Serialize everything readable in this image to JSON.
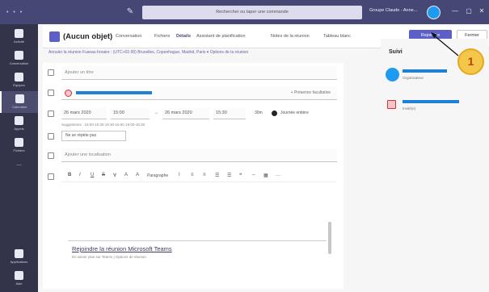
{
  "topbar": {
    "search_placeholder": "Rechercher ou taper une commande",
    "tenant_label": "Groupe Claude - Anne...",
    "minimize_glyph": "—",
    "maximize_glyph": "▢"
  },
  "rail": {
    "items": [
      {
        "label": "Activité",
        "icon": "bell-icon"
      },
      {
        "label": "Conversation",
        "icon": "chat-icon"
      },
      {
        "label": "Équipes",
        "icon": "teams-icon"
      },
      {
        "label": "Calendrier",
        "icon": "calendar-icon"
      },
      {
        "label": "Appels",
        "icon": "phone-icon"
      },
      {
        "label": "Fichiers",
        "icon": "file-icon"
      },
      {
        "label": "...",
        "icon": "more-icon"
      }
    ],
    "bottom_items": [
      {
        "label": "Applications",
        "icon": "apps-icon"
      },
      {
        "label": "Aide",
        "icon": "help-icon"
      }
    ]
  },
  "meeting": {
    "title": "(Aucun objet)",
    "tabs": [
      "Conversation",
      "Fichiers",
      "Détails",
      "Assistant de planification",
      "Notes de la réunion",
      "Tableau blanc"
    ],
    "active_tab_index": 2,
    "join_button": "Rejoindre",
    "close_button": "Fermer",
    "timezone_row": "Annuler la réunion   Fuseau horaire : (UTC+01:00) Bruxelles, Copenhague, Madrid, Paris  ▾   Options de la réunion"
  },
  "form": {
    "title_placeholder": "Ajouter un titre",
    "optional_label": "+ Présence facultative",
    "start_date": "26 mars 2020",
    "start_time": "15:00",
    "end_date": "26 mars 2020",
    "end_time": "15:30",
    "duration": "30m",
    "all_day_label": "Journée entière",
    "suggestions": "Suggestions : 15:00-15:30   15:30-16:00   16:00-16:30",
    "repeat_value": "Ne se répète pas",
    "location_placeholder": "Ajouter une localisation",
    "toolbar_tools": [
      "B",
      "I",
      "U",
      "S",
      "∀",
      "A",
      "A",
      "Paragraphe",
      "Ι",
      "≡",
      "≡",
      "☰",
      "☰",
      "❝",
      "⇔",
      "▦",
      "…"
    ],
    "join_link_text": "Rejoindre la réunion Microsoft Teams",
    "join_sub_text": "En savoir plus sur Teams | Options de réunion"
  },
  "right_panel": {
    "title": "Suivi",
    "organizer_role": "Organisateur",
    "attendee_role": "Invité(e)"
  },
  "callout": {
    "number": "1"
  },
  "colors": {
    "teams_purple": "#464775",
    "join_button": "#5b5fc7",
    "badge_fill": "#f3c74a",
    "redaction_blue": "#1e80d6"
  }
}
